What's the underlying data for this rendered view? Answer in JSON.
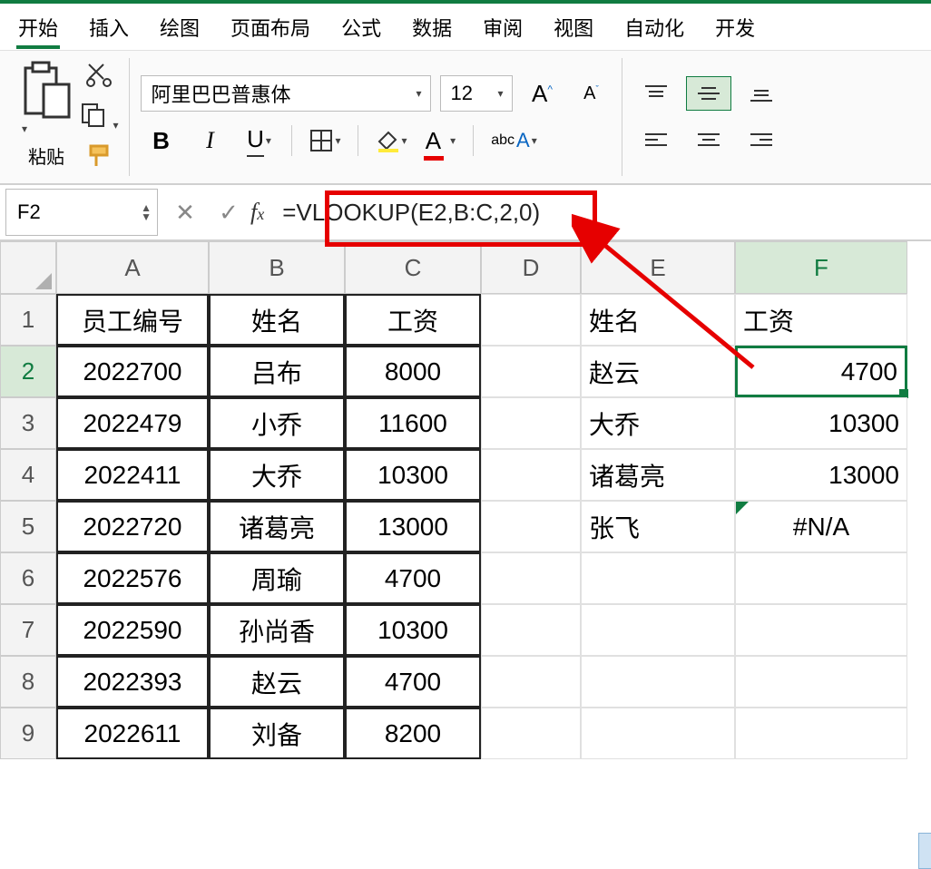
{
  "tabs": {
    "t0": "开始",
    "t1": "插入",
    "t2": "绘图",
    "t3": "页面布局",
    "t4": "公式",
    "t5": "数据",
    "t6": "审阅",
    "t7": "视图",
    "t8": "自动化",
    "t9": "开发"
  },
  "ribbon": {
    "paste_label": "粘贴",
    "font_name": "阿里巴巴普惠体",
    "font_size": "12",
    "bold": "B",
    "italic": "I",
    "underline": "U",
    "abc": "abc"
  },
  "namebox": "F2",
  "formula": "=VLOOKUP(E2,B:C,2,0)",
  "columns": [
    "A",
    "B",
    "C",
    "D",
    "E",
    "F"
  ],
  "rows": [
    "1",
    "2",
    "3",
    "4",
    "5",
    "6",
    "7",
    "8",
    "9"
  ],
  "grid": {
    "h": {
      "A": "员工编号",
      "B": "姓名",
      "C": "工资",
      "E": "姓名",
      "F": "工资"
    },
    "r2": {
      "A": "2022700",
      "B": "吕布",
      "C": "8000",
      "E": "赵云",
      "F": "4700"
    },
    "r3": {
      "A": "2022479",
      "B": "小乔",
      "C": "11600",
      "E": "大乔",
      "F": "10300"
    },
    "r4": {
      "A": "2022411",
      "B": "大乔",
      "C": "10300",
      "E": "诸葛亮",
      "F": "13000"
    },
    "r5": {
      "A": "2022720",
      "B": "诸葛亮",
      "C": "13000",
      "E": "张飞",
      "F": "#N/A"
    },
    "r6": {
      "A": "2022576",
      "B": "周瑜",
      "C": "4700"
    },
    "r7": {
      "A": "2022590",
      "B": "孙尚香",
      "C": "10300"
    },
    "r8": {
      "A": "2022393",
      "B": "赵云",
      "C": "4700"
    },
    "r9": {
      "A": "2022611",
      "B": "刘备",
      "C": "8200"
    }
  },
  "colors": {
    "accent": "#107c41",
    "highlight": "#e60000"
  }
}
